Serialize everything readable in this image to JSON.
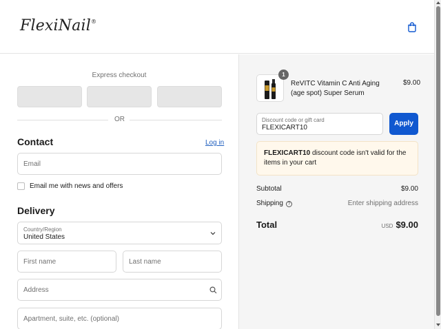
{
  "header": {
    "brand": "FlexiNail",
    "brand_mark": "®"
  },
  "express": {
    "title": "Express checkout",
    "or_label": "OR"
  },
  "contact": {
    "title": "Contact",
    "login_link": "Log in",
    "email_placeholder": "Email",
    "newsletter_label": "Email me with news and offers"
  },
  "delivery": {
    "title": "Delivery",
    "country_label": "Country/Region",
    "country_value": "United States",
    "first_name_placeholder": "First name",
    "last_name_placeholder": "Last name",
    "address_placeholder": "Address",
    "apartment_placeholder": "Apartment, suite, etc. (optional)"
  },
  "summary": {
    "product": {
      "name": "ReVITC Vitamin C Anti Aging (age spot) Super Serum",
      "price": "$9.00",
      "quantity": "1"
    },
    "discount": {
      "label": "Discount code or gift card",
      "value": "FLEXICART10",
      "apply_label": "Apply"
    },
    "alert": {
      "code": "FLEXICART10",
      "message": "discount code isn't valid for the items in your cart"
    },
    "subtotal_label": "Subtotal",
    "subtotal_value": "$9.00",
    "shipping_label": "Shipping",
    "shipping_value": "Enter shipping address",
    "total_label": "Total",
    "currency": "USD",
    "total_value": "$9.00"
  },
  "colors": {
    "accent": "#1058d0",
    "link": "#1f5fbf",
    "alert_bg": "#fff8ec"
  }
}
